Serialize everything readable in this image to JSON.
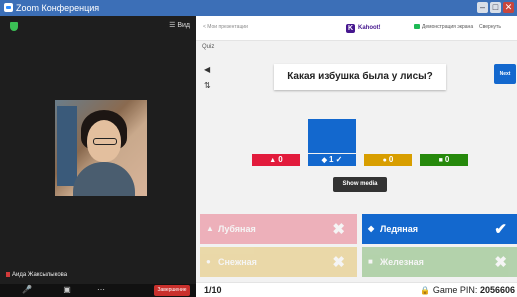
{
  "window": {
    "title": "Zoom Конференция"
  },
  "zoom": {
    "view_label": "Вид",
    "participant_name": "Аида Жаксылыкова",
    "end_label": "Завершение"
  },
  "kahoot": {
    "back_label": "< Мои презентации",
    "logo_text": "Kahoot!",
    "share_label": "Демонстрация экрана",
    "collapse_label": "Свернуть",
    "quiz_label": "Quiz",
    "question": "Какая избушка была у лисы?",
    "next_label": "Next",
    "show_media_label": "Show media",
    "results": [
      {
        "shape": "▲",
        "count": "0",
        "value": 0,
        "color": "#e21b3c"
      },
      {
        "shape": "◆",
        "count": "1 ✓",
        "value": 1,
        "color": "#1368ce"
      },
      {
        "shape": "●",
        "count": "0",
        "value": 0,
        "color": "#d89e00"
      },
      {
        "shape": "■",
        "count": "0",
        "value": 0,
        "color": "#26890c"
      }
    ],
    "answers": [
      {
        "shape": "▲",
        "label": "Лубяная",
        "mark": "✖",
        "correct": false
      },
      {
        "shape": "◆",
        "label": "Ледяная",
        "mark": "✔",
        "correct": true
      },
      {
        "shape": "●",
        "label": "Снежная",
        "mark": "✖",
        "correct": false
      },
      {
        "shape": "■",
        "label": "Железная",
        "mark": "✖",
        "correct": false
      }
    ],
    "progress": "1/10",
    "pin_label": "Game PIN:",
    "pin_value": "2056606"
  }
}
